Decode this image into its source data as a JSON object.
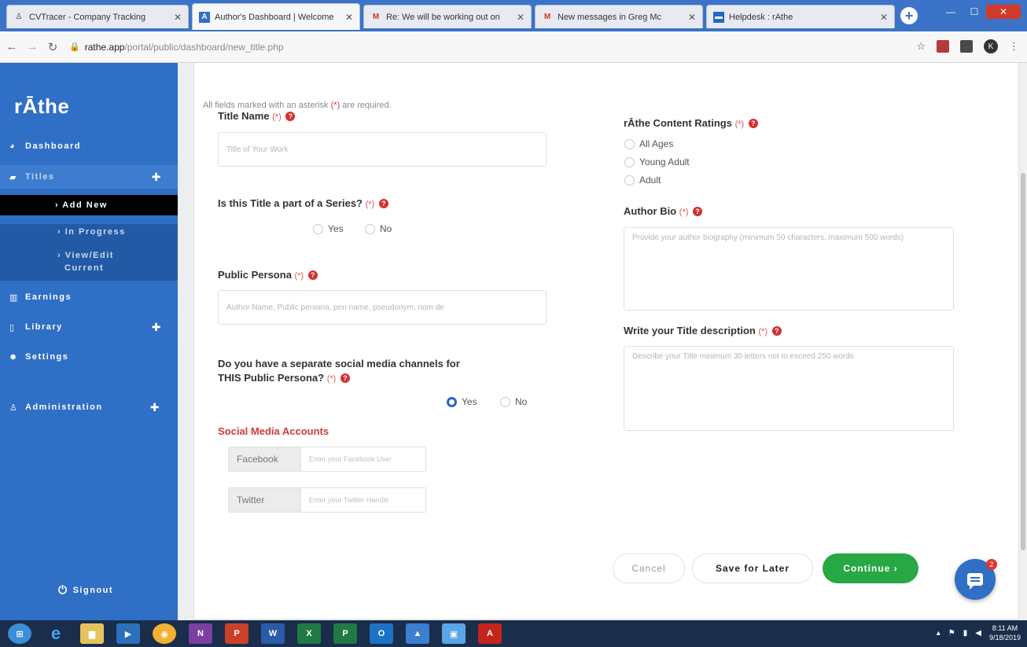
{
  "browser": {
    "tabs": [
      {
        "title": "CVTracer - Company Tracking",
        "icon": "company-favicon"
      },
      {
        "title": "Author's Dashboard | Welcome",
        "icon": "rathe-favicon"
      },
      {
        "title": "Re: We will be working out on",
        "icon": "gmail-favicon"
      },
      {
        "title": "New messages in Greg Mc",
        "icon": "gmail-favicon"
      },
      {
        "title": "Helpdesk : rAthe",
        "icon": "helpdesk-favicon"
      }
    ],
    "url_host": "rathe.app",
    "url_path": "/portal/public/dashboard/new_title.php",
    "profile_initial": "K"
  },
  "sidebar": {
    "logo": "rĀthe",
    "items": {
      "dashboard": "Dashboard",
      "titles": "Titles",
      "add_new": "› Add New",
      "in_progress": "› In Progress",
      "view_edit_1": "› View/Edit",
      "view_edit_2": "Current",
      "earnings": "Earnings",
      "library": "Library",
      "settings": "Settings",
      "administration": "Administration",
      "signout": "Signout"
    }
  },
  "form": {
    "required_note": "All fields marked with an asterisk",
    "required_mark": "(*)",
    "required_note_end": "are required.",
    "title_name": {
      "label": "Title Name",
      "placeholder": "Title of Your Work"
    },
    "series": {
      "label": "Is this Title a part of a Series?",
      "yes": "Yes",
      "no": "No"
    },
    "persona": {
      "label": "Public Persona",
      "placeholder": "Author Name, Public persona, pen name, pseudonym, nom de"
    },
    "social_q": {
      "label_1": "Do you have a separate social media channels for",
      "label_2": "THIS Public Persona?",
      "yes": "Yes",
      "no": "No",
      "selected": "Yes"
    },
    "social_accounts": {
      "title": "Social Media Accounts",
      "facebook_label": "Facebook",
      "facebook_placeholder": "Enter your Facebook User",
      "twitter_label": "Twitter",
      "twitter_placeholder": "Enter your Twitter Handle"
    },
    "ratings": {
      "label": "rĀthe Content Ratings",
      "options": [
        "All Ages",
        "Young Adult",
        "Adult"
      ]
    },
    "bio": {
      "label": "Author Bio",
      "placeholder": "Provide your author biography (minimum 50 characters, maximum 500 words)"
    },
    "description": {
      "label": "Write your Title description",
      "placeholder": "Describe your Title minimum 30 letters not to exceed 250 words"
    },
    "required_marker": "(*)",
    "help_glyph": "?"
  },
  "actions": {
    "cancel": "Cancel",
    "save": "Save for Later",
    "continue": "Continue ›"
  },
  "chat": {
    "badge": "2"
  },
  "taskbar": {
    "time": "8:11 AM",
    "date": "9/18/2019"
  }
}
